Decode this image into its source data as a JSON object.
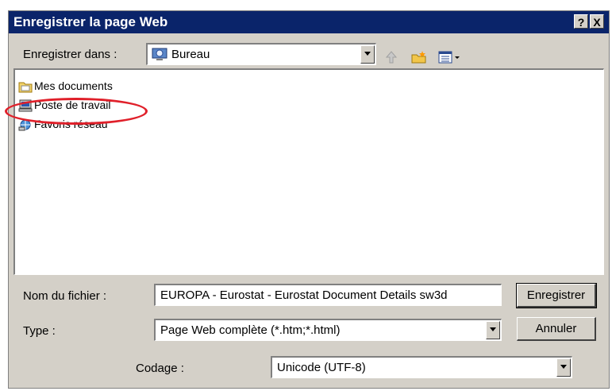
{
  "window": {
    "title": "Enregistrer la page Web",
    "help_label": "?",
    "close_label": "X"
  },
  "location": {
    "label": "Enregistrer dans :",
    "value": "Bureau",
    "icon": "desktop-icon"
  },
  "toolbar": {
    "icons": [
      "up-folder-icon",
      "new-folder-icon",
      "view-menu-icon"
    ]
  },
  "file_list": {
    "items": [
      {
        "label": "Mes documents",
        "icon": "folder-icon"
      },
      {
        "label": "Poste de travail",
        "icon": "computer-icon",
        "highlighted": true
      },
      {
        "label": "Favoris réseau",
        "icon": "network-icon"
      }
    ]
  },
  "filename": {
    "label": "Nom du fichier :",
    "value": "EUROPA - Eurostat - Eurostat Document Details sw3d"
  },
  "type": {
    "label": "Type :",
    "value": "Page Web complète (*.htm;*.html)"
  },
  "encoding": {
    "label": "Codage :",
    "value": "Unicode (UTF-8)"
  },
  "buttons": {
    "save_label": "Enregistrer",
    "cancel_label": "Annuler"
  },
  "colors": {
    "titlebar": "#0a246a",
    "dialog_bg": "#d4d0c8",
    "highlight_circle": "#e0202a"
  }
}
